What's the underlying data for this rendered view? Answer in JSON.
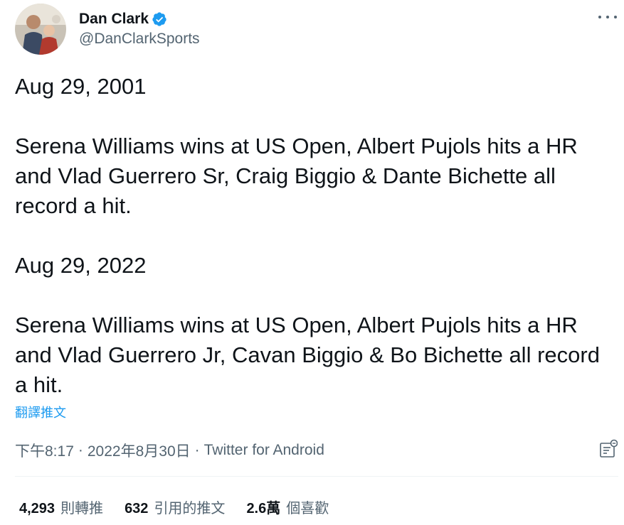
{
  "author": {
    "display_name": "Dan Clark",
    "handle": "@DanClarkSports",
    "verified_color": "#1d9bf0"
  },
  "tweet": {
    "paragraphs": [
      "Aug 29, 2001",
      "Serena Williams wins at US Open, Albert Pujols hits a HR and Vlad Guerrero Sr, Craig Biggio & Dante Bichette all record a hit.",
      "Aug 29, 2022",
      "Serena Williams wins at US Open, Albert Pujols hits a HR and Vlad Guerrero Jr, Cavan Biggio & Bo Bichette all record a hit."
    ],
    "translate_label": "翻譯推文"
  },
  "meta": {
    "time": "下午8:17",
    "date": "2022年8月30日",
    "separator": "·",
    "source": "Twitter for Android"
  },
  "stats": {
    "retweets_count": "4,293",
    "retweets_label": "則轉推",
    "quotes_count": "632",
    "quotes_label": "引用的推文",
    "likes_count": "2.6萬",
    "likes_label": "個喜歡"
  },
  "icons": {
    "more": "more-horizontal-icon",
    "analytics": "analytics-icon",
    "verified": "verified-badge-icon"
  }
}
